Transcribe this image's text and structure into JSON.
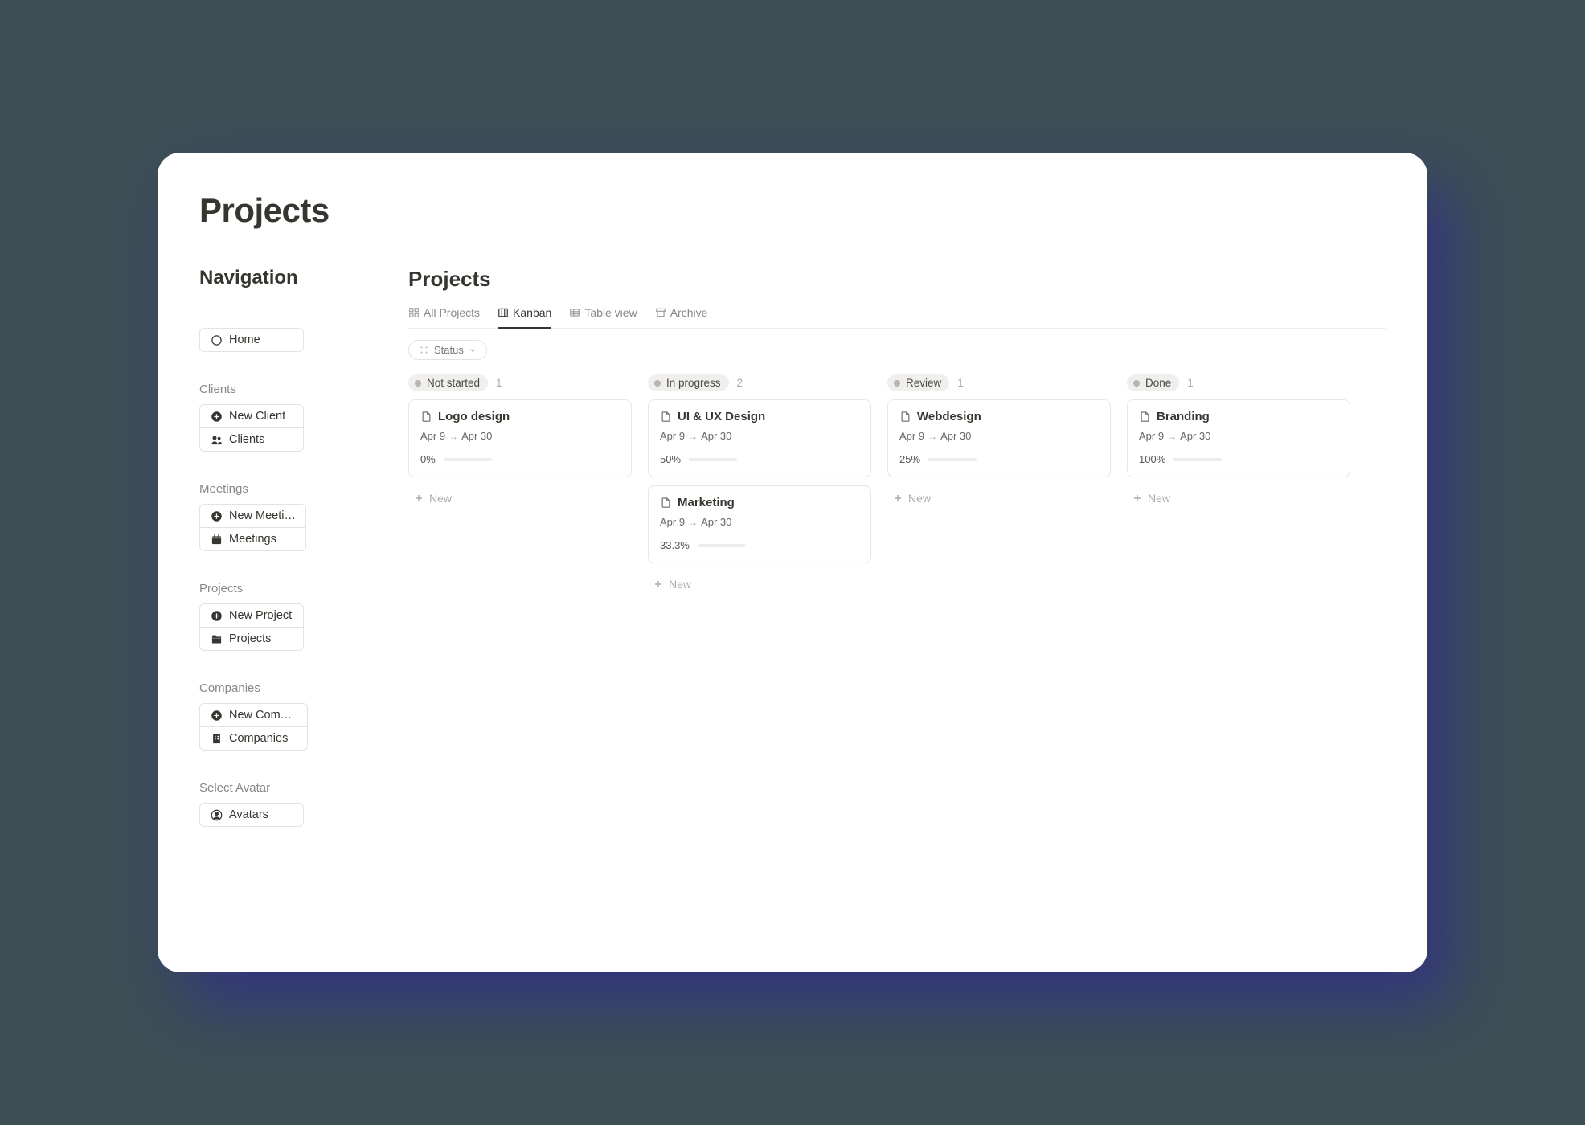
{
  "page_title": "Projects",
  "nav_heading": "Navigation",
  "nav_groups": [
    {
      "label": "",
      "items": [
        {
          "icon": "circle",
          "label": "Home"
        }
      ]
    },
    {
      "label": "Clients",
      "items": [
        {
          "icon": "plus-circle",
          "label": "New Client"
        },
        {
          "icon": "people",
          "label": "Clients"
        }
      ]
    },
    {
      "label": "Meetings",
      "items": [
        {
          "icon": "plus-circle",
          "label": "New Meeti…"
        },
        {
          "icon": "calendar",
          "label": "Meetings"
        }
      ]
    },
    {
      "label": "Projects",
      "items": [
        {
          "icon": "plus-circle",
          "label": "New Project"
        },
        {
          "icon": "folder",
          "label": "Projects"
        }
      ]
    },
    {
      "label": "Companies",
      "items": [
        {
          "icon": "plus-circle",
          "label": "New Comp…"
        },
        {
          "icon": "building",
          "label": "Companies"
        }
      ]
    },
    {
      "label": "Select Avatar",
      "items": [
        {
          "icon": "user-circle",
          "label": "Avatars"
        }
      ]
    }
  ],
  "main_title": "Projects",
  "tabs": [
    {
      "icon": "grid",
      "label": "All Projects",
      "active": false
    },
    {
      "icon": "kanban",
      "label": "Kanban",
      "active": true
    },
    {
      "icon": "table",
      "label": "Table view",
      "active": false
    },
    {
      "icon": "archive",
      "label": "Archive",
      "active": false
    }
  ],
  "filter": {
    "label": "Status"
  },
  "new_label": "New",
  "columns": [
    {
      "status": "Not started",
      "count": 1,
      "cards": [
        {
          "title": "Logo design",
          "date_from": "Apr 9",
          "date_to": "Apr 30",
          "progress_text": "0%",
          "progress_pct": 0
        }
      ]
    },
    {
      "status": "In progress",
      "count": 2,
      "cards": [
        {
          "title": "UI & UX Design",
          "date_from": "Apr 9",
          "date_to": "Apr 30",
          "progress_text": "50%",
          "progress_pct": 50
        },
        {
          "title": "Marketing",
          "date_from": "Apr 9",
          "date_to": "Apr 30",
          "progress_text": "33.3%",
          "progress_pct": 33.3
        }
      ]
    },
    {
      "status": "Review",
      "count": 1,
      "cards": [
        {
          "title": "Webdesign",
          "date_from": "Apr 9",
          "date_to": "Apr 30",
          "progress_text": "25%",
          "progress_pct": 25
        }
      ]
    },
    {
      "status": "Done",
      "count": 1,
      "cards": [
        {
          "title": "Branding",
          "date_from": "Apr 9",
          "date_to": "Apr 30",
          "progress_text": "100%",
          "progress_pct": 100
        }
      ]
    }
  ]
}
